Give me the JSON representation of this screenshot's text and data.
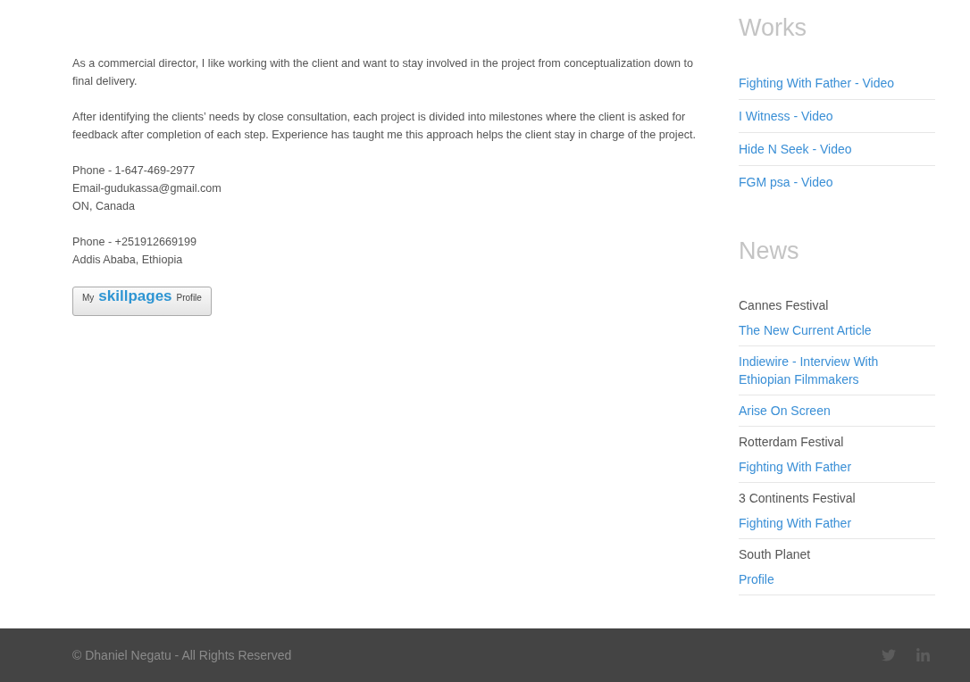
{
  "about": {
    "paragraphs": [
      "As a commercial director, I like working with the client and want to stay involved in the project from conceptualization down to final delivery.",
      "After identifying the clients’ needs by close consultation, each project is divided into milestones where the client is asked for feedback after completion of each step. Experience has taught me this approach helps the client stay in charge of the project."
    ],
    "contacts": [
      [
        "Phone - 1-647-469-2977",
        "Email-gudukassa@gmail.com",
        "ON, Canada"
      ],
      [
        "Phone - +251912669199",
        "Addis Ababa, Ethiopia"
      ]
    ],
    "profile_button": {
      "prefix": "My",
      "brand": "skillpages",
      "suffix": "Profile"
    }
  },
  "sidebar": {
    "works": {
      "title": "Works",
      "links": [
        "Fighting With Father - Video",
        "I Witness - Video",
        "Hide N Seek - Video",
        "FGM psa - Video"
      ]
    },
    "news": {
      "title": "News",
      "items": [
        {
          "source": "Cannes Festival",
          "link": "The New Current Article"
        },
        {
          "link": "Indiewire - Interview With Ethiopian Filmmakers"
        },
        {
          "link": "Arise On Screen"
        },
        {
          "source": "Rotterdam Festival",
          "link": "Fighting With Father"
        },
        {
          "source": "3 Continents Festival",
          "link": "Fighting With Father"
        },
        {
          "source": "South Planet",
          "link": "Profile"
        }
      ]
    }
  },
  "footer": {
    "copyright": "© Dhaniel Negatu - All Rights Reserved",
    "social": [
      {
        "kind": "twitter"
      },
      {
        "kind": "linkedin"
      }
    ]
  }
}
